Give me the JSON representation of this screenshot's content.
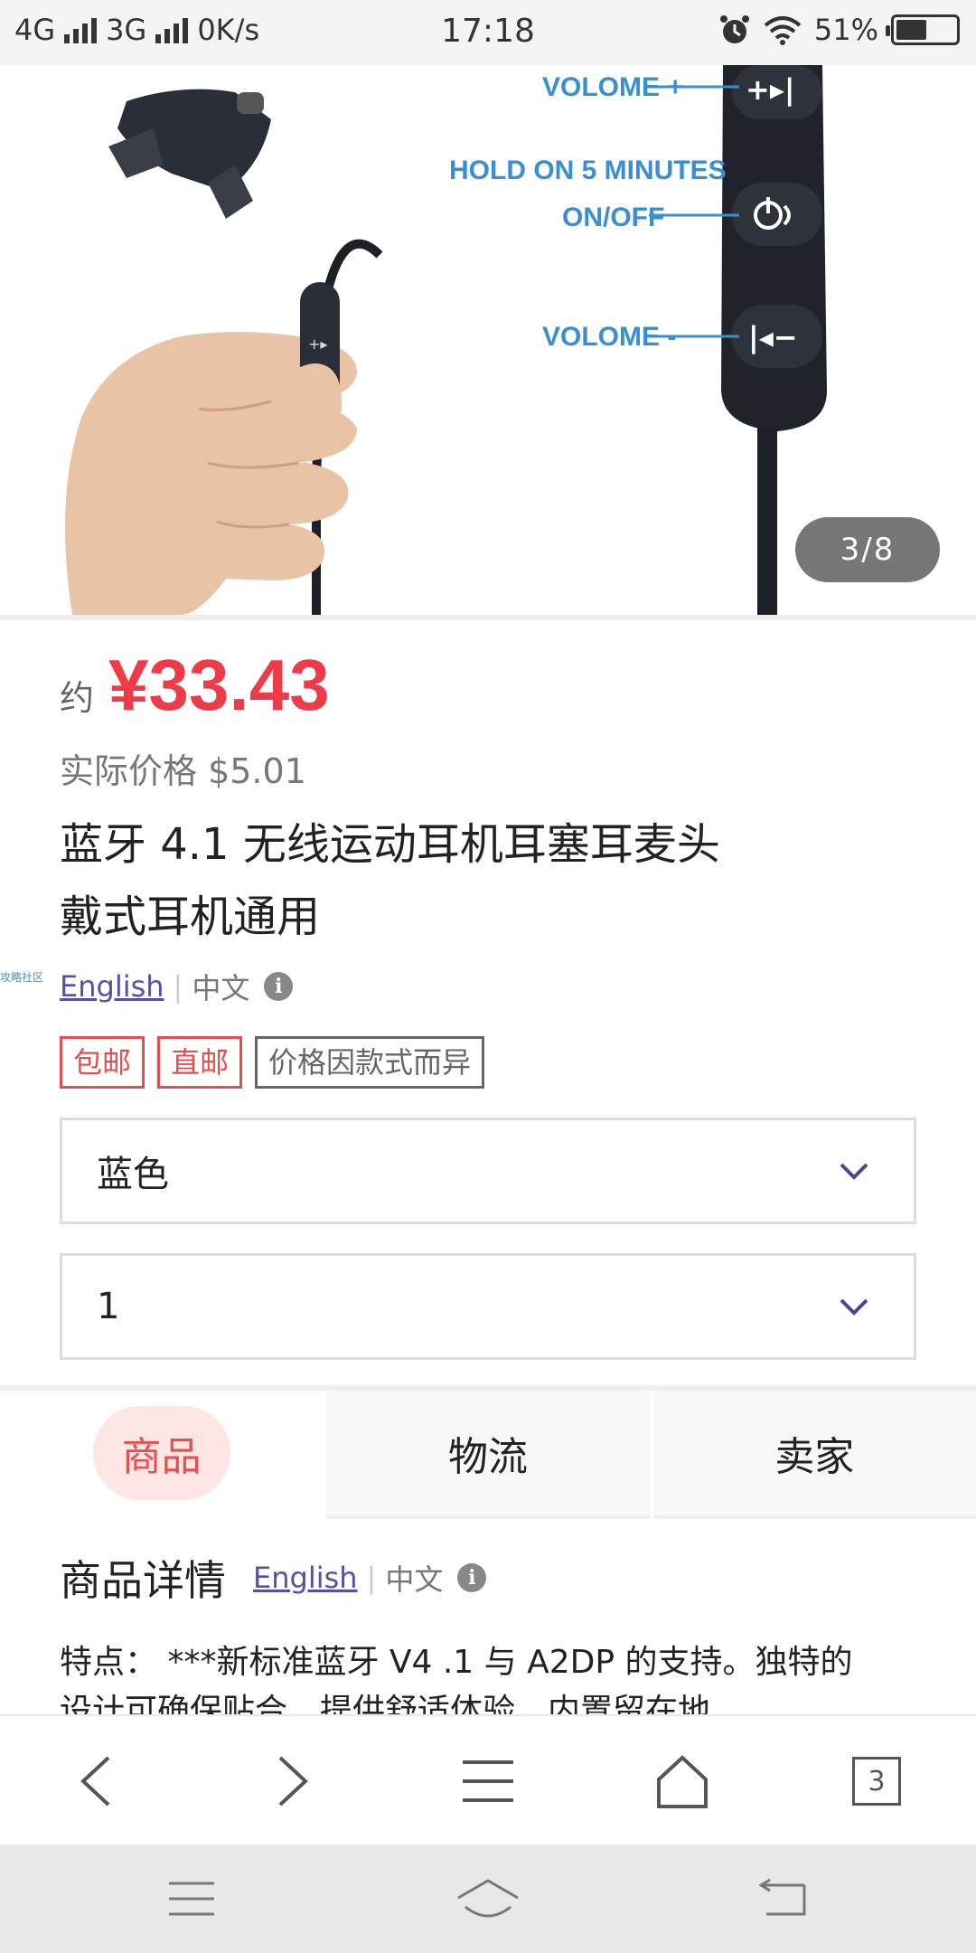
{
  "status_bar": {
    "network_1": "4G",
    "network_2": "3G",
    "speed": "0K/s",
    "time": "17:18",
    "battery_percent": "51%",
    "battery_level": 0.51
  },
  "image": {
    "labels": {
      "vol_up": "VOLOME +",
      "hold": "HOLD ON 5 MINUTES",
      "onoff": "ON/OFF",
      "vol_down": "VOLOME -"
    },
    "counter": "3/8"
  },
  "product": {
    "price_prefix": "约",
    "price": "¥33.43",
    "actual_price": "实际价格 $5.01",
    "title_line1": "蓝牙 4.1 无线运动耳机耳塞耳麦头",
    "title_line2": "戴式耳机通用",
    "lang_en": "English",
    "lang_zh": "中文",
    "watermark": "攻略社区",
    "tags": [
      "包邮",
      "直邮",
      "价格因款式而异"
    ],
    "color_select": "蓝色",
    "qty_select": "1"
  },
  "tabs": [
    "商品",
    "物流",
    "卖家"
  ],
  "details": {
    "heading": "商品详情",
    "lang_en": "English",
    "lang_zh": "中文",
    "text": "特点： ***新标准蓝牙 V4 .1 与 A2DP 的支持。独特的设计可确保贴合，提供舒适体验，内置留在地"
  },
  "browser_bar": {
    "tab_count": "3"
  },
  "colors": {
    "accent_red": "#ee3b4a",
    "link_purple": "#5b4ea6",
    "label_blue": "#3a8fd0"
  }
}
